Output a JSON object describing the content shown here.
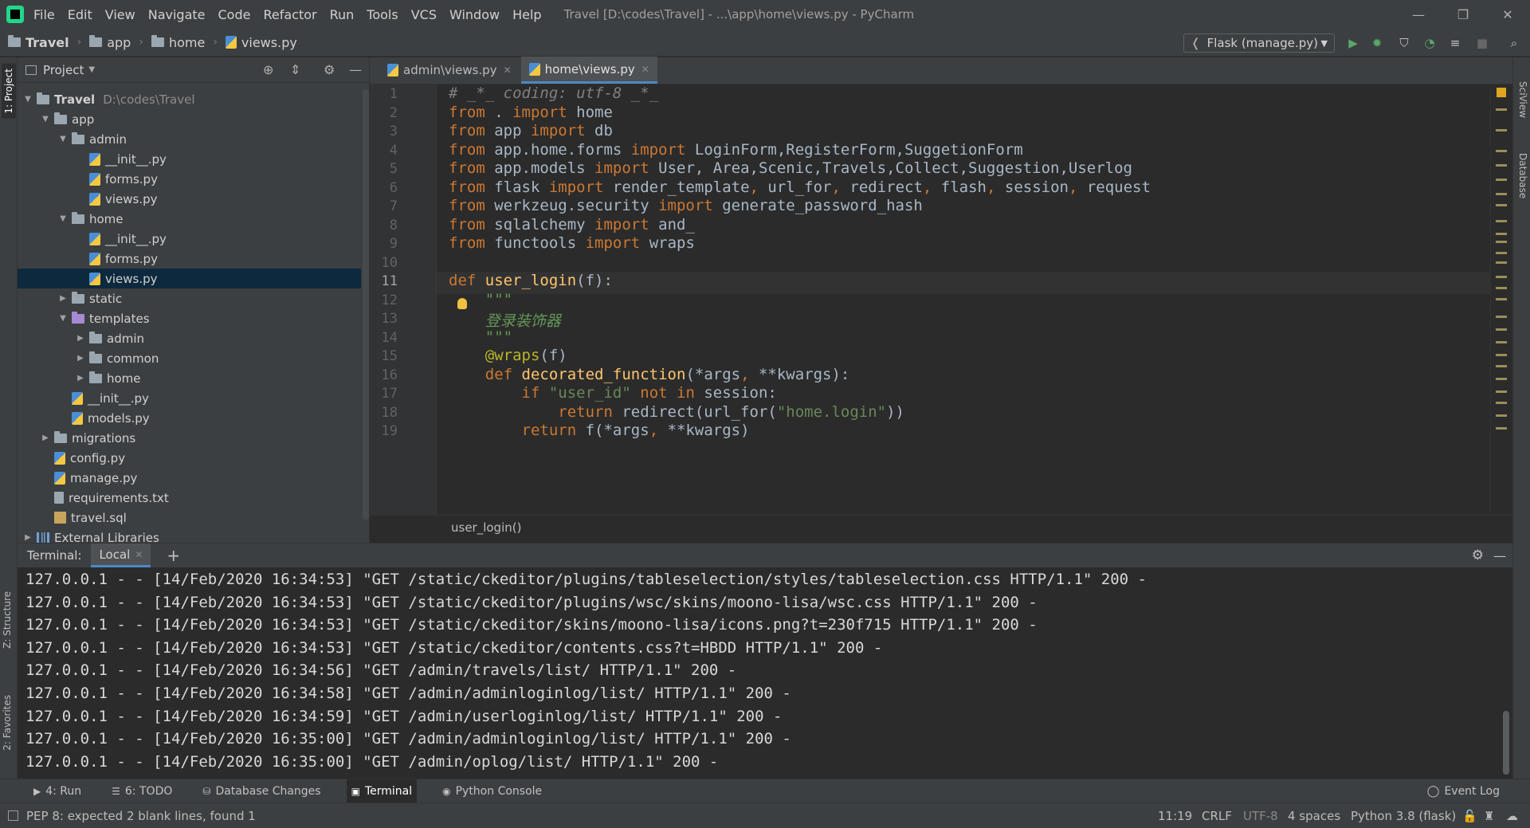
{
  "app": {
    "window_title": "Travel [D:\\codes\\Travel] - ...\\app\\home\\views.py - PyCharm",
    "menu": [
      "File",
      "Edit",
      "View",
      "Navigate",
      "Code",
      "Refactor",
      "Run",
      "Tools",
      "VCS",
      "Window",
      "Help"
    ],
    "window_controls": {
      "minimize": "—",
      "restore": "❐",
      "close": "✕"
    }
  },
  "navbar": {
    "breadcrumbs": [
      "Travel",
      "app",
      "home",
      "views.py"
    ],
    "run_config": "Flask (manage.py)"
  },
  "left_strip": {
    "project_tab": "1: Project",
    "structure_tab": "Z: Structure",
    "favorites_tab": "2: Favorites"
  },
  "right_strip": {
    "sciview_tab": "SciView",
    "database_tab": "Database"
  },
  "project": {
    "title": "Project",
    "tree": [
      {
        "label": "Travel",
        "path": "D:\\codes\\Travel",
        "type": "folder",
        "depth": 0,
        "expanded": true
      },
      {
        "label": "app",
        "type": "folder",
        "depth": 1,
        "expanded": true
      },
      {
        "label": "admin",
        "type": "folder",
        "depth": 2,
        "expanded": true
      },
      {
        "label": "__init__.py",
        "type": "py",
        "depth": 3
      },
      {
        "label": "forms.py",
        "type": "py",
        "depth": 3
      },
      {
        "label": "views.py",
        "type": "py",
        "depth": 3
      },
      {
        "label": "home",
        "type": "folder",
        "depth": 2,
        "expanded": true
      },
      {
        "label": "__init__.py",
        "type": "py",
        "depth": 3
      },
      {
        "label": "forms.py",
        "type": "py",
        "depth": 3
      },
      {
        "label": "views.py",
        "type": "py",
        "depth": 3,
        "selected": true
      },
      {
        "label": "static",
        "type": "folder",
        "depth": 2,
        "expanded": false
      },
      {
        "label": "templates",
        "type": "folder-purple",
        "depth": 2,
        "expanded": true
      },
      {
        "label": "admin",
        "type": "folder",
        "depth": 3,
        "expanded": false
      },
      {
        "label": "common",
        "type": "folder",
        "depth": 3,
        "expanded": false
      },
      {
        "label": "home",
        "type": "folder",
        "depth": 3,
        "expanded": false
      },
      {
        "label": "__init__.py",
        "type": "py",
        "depth": 2
      },
      {
        "label": "models.py",
        "type": "py",
        "depth": 2
      },
      {
        "label": "migrations",
        "type": "folder",
        "depth": 1,
        "expanded": false
      },
      {
        "label": "config.py",
        "type": "py",
        "depth": 1
      },
      {
        "label": "manage.py",
        "type": "py",
        "depth": 1
      },
      {
        "label": "requirements.txt",
        "type": "txt",
        "depth": 1
      },
      {
        "label": "travel.sql",
        "type": "sql",
        "depth": 1
      },
      {
        "label": "External Libraries",
        "type": "lib",
        "depth": 0,
        "expanded": false
      }
    ]
  },
  "editor": {
    "tabs": [
      {
        "label": "admin\\views.py",
        "active": false
      },
      {
        "label": "home\\views.py",
        "active": true
      }
    ],
    "current_line": 11,
    "lines": [
      [
        [
          "cm",
          "# _*_ coding: utf-8 _*_"
        ]
      ],
      [
        [
          "kw",
          "from"
        ],
        [
          "",
          " . "
        ],
        [
          "kw",
          "import"
        ],
        [
          "",
          " home"
        ]
      ],
      [
        [
          "kw",
          "from"
        ],
        [
          "",
          " app "
        ],
        [
          "kw",
          "import"
        ],
        [
          "",
          " db"
        ]
      ],
      [
        [
          "kw",
          "from"
        ],
        [
          "",
          " app.home.forms "
        ],
        [
          "kw",
          "import"
        ],
        [
          "",
          " LoginForm,RegisterForm,SuggetionForm"
        ]
      ],
      [
        [
          "kw",
          "from"
        ],
        [
          "",
          " app.models "
        ],
        [
          "kw",
          "import"
        ],
        [
          "",
          " User, Area,Scenic,Travels,Collect,Suggestion,Userlog"
        ]
      ],
      [
        [
          "kw",
          "from"
        ],
        [
          "",
          " flask "
        ],
        [
          "kw",
          "import"
        ],
        [
          "",
          " render_template"
        ],
        [
          "kw",
          ","
        ],
        [
          "",
          " url_for"
        ],
        [
          "kw",
          ","
        ],
        [
          "",
          " redirect"
        ],
        [
          "kw",
          ","
        ],
        [
          "",
          " flash"
        ],
        [
          "kw",
          ","
        ],
        [
          "",
          " session"
        ],
        [
          "kw",
          ","
        ],
        [
          "",
          " request"
        ]
      ],
      [
        [
          "kw",
          "from"
        ],
        [
          "",
          " werkzeug.security "
        ],
        [
          "kw",
          "import"
        ],
        [
          "",
          " generate_password_hash"
        ]
      ],
      [
        [
          "kw",
          "from"
        ],
        [
          "",
          " sqlalchemy "
        ],
        [
          "kw",
          "import"
        ],
        [
          "",
          " and_"
        ]
      ],
      [
        [
          "kw",
          "from"
        ],
        [
          "",
          " functools "
        ],
        [
          "kw",
          "import"
        ],
        [
          "",
          " wraps"
        ]
      ],
      [],
      [
        [
          "kw",
          "def"
        ],
        [
          "",
          " "
        ],
        [
          "fn",
          "user_login"
        ],
        [
          "",
          "(f):"
        ]
      ],
      [
        [
          "doc",
          "    \"\"\""
        ]
      ],
      [
        [
          "doc",
          "    登录装饰器"
        ]
      ],
      [
        [
          "doc",
          "    \"\"\""
        ]
      ],
      [
        [
          "dec",
          "    @wraps"
        ],
        [
          "",
          "(f)"
        ]
      ],
      [
        [
          "kw",
          "    def"
        ],
        [
          "",
          " "
        ],
        [
          "fn",
          "decorated_function"
        ],
        [
          "",
          "(*args"
        ],
        [
          "kw",
          ","
        ],
        [
          "",
          " **kwargs):"
        ]
      ],
      [
        [
          "kw",
          "        if"
        ],
        [
          "",
          " "
        ],
        [
          "str",
          "\"user_id\""
        ],
        [
          "",
          " "
        ],
        [
          "kw",
          "not in"
        ],
        [
          "",
          " session:"
        ]
      ],
      [
        [
          "kw",
          "            return"
        ],
        [
          "",
          " redirect(url_for("
        ],
        [
          "str",
          "\"home.login\""
        ],
        [
          "",
          "))"
        ]
      ],
      [
        [
          "kw",
          "        return"
        ],
        [
          "",
          " f(*args"
        ],
        [
          "kw",
          ","
        ],
        [
          "",
          " **kwargs)"
        ]
      ]
    ],
    "function_breadcrumb": "user_login()"
  },
  "terminal": {
    "label": "Terminal:",
    "tab": "Local",
    "add_symbol": "+",
    "lines": [
      "127.0.0.1 - - [14/Feb/2020 16:34:53] \"GET /static/ckeditor/plugins/tableselection/styles/tableselection.css HTTP/1.1\" 200 -",
      "127.0.0.1 - - [14/Feb/2020 16:34:53] \"GET /static/ckeditor/plugins/wsc/skins/moono-lisa/wsc.css HTTP/1.1\" 200 -",
      "127.0.0.1 - - [14/Feb/2020 16:34:53] \"GET /static/ckeditor/skins/moono-lisa/icons.png?t=230f715 HTTP/1.1\" 200 -",
      "127.0.0.1 - - [14/Feb/2020 16:34:53] \"GET /static/ckeditor/contents.css?t=HBDD HTTP/1.1\" 200 -",
      "127.0.0.1 - - [14/Feb/2020 16:34:56] \"GET /admin/travels/list/ HTTP/1.1\" 200 -",
      "127.0.0.1 - - [14/Feb/2020 16:34:58] \"GET /admin/adminloginlog/list/ HTTP/1.1\" 200 -",
      "127.0.0.1 - - [14/Feb/2020 16:34:59] \"GET /admin/userloginlog/list/ HTTP/1.1\" 200 -",
      "127.0.0.1 - - [14/Feb/2020 16:35:00] \"GET /admin/adminloginlog/list/ HTTP/1.1\" 200 -",
      "127.0.0.1 - - [14/Feb/2020 16:35:00] \"GET /admin/oplog/list/ HTTP/1.1\" 200 -"
    ]
  },
  "tool_tabs": {
    "run": "4: Run",
    "todo": "6: TODO",
    "db_changes": "Database Changes",
    "terminal": "Terminal",
    "python_console": "Python Console",
    "event_log": "Event Log"
  },
  "status": {
    "message": "PEP 8: expected 2 blank lines, found 1",
    "position": "11:19",
    "line_sep": "CRLF",
    "encoding": "UTF-8",
    "indent": "4 spaces",
    "interpreter": "Python 3.8 (flask)"
  },
  "colors": {
    "background": "#2b2b2b",
    "panel": "#3c3f41",
    "keyword": "#cc7832",
    "function": "#ffc66d",
    "string": "#6a8759",
    "selection": "#0d293e",
    "accent": "#4a88c7",
    "run_green": "#59a869"
  }
}
